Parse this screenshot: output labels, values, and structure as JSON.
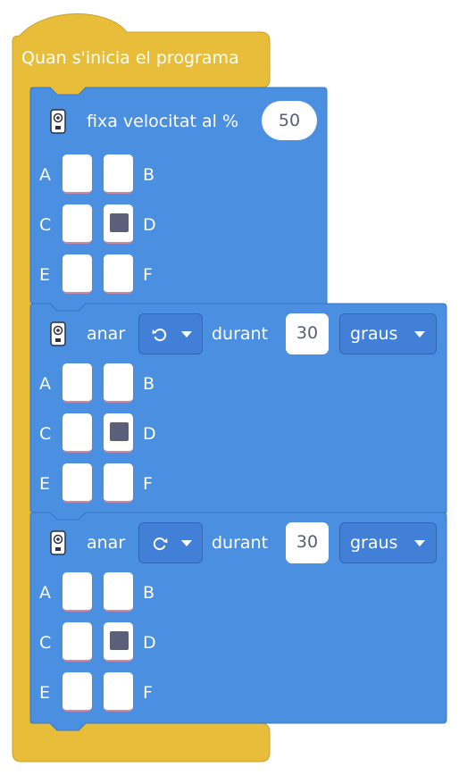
{
  "colors": {
    "event_yellow": "#e8bd3a",
    "motor_blue": "#4a8fe0",
    "port_filled": "#5b5f79",
    "value_text": "#575e75"
  },
  "hat": {
    "label": "Quan s'inicia el programa"
  },
  "blocks": [
    {
      "icon": "hub-icon",
      "label": "fixa velocitat al %",
      "value": "50",
      "ports": {
        "a": "A",
        "b": "B",
        "c": "C",
        "d": "D",
        "e": "E",
        "f": "F"
      },
      "selected_port": "D"
    },
    {
      "icon": "hub-icon",
      "label": "anar",
      "direction_icon": "counterclockwise-icon",
      "durant_label": "durant",
      "value": "30",
      "unit": "graus",
      "ports": {
        "a": "A",
        "b": "B",
        "c": "C",
        "d": "D",
        "e": "E",
        "f": "F"
      },
      "selected_port": "D"
    },
    {
      "icon": "hub-icon",
      "label": "anar",
      "direction_icon": "clockwise-icon",
      "durant_label": "durant",
      "value": "30",
      "unit": "graus",
      "ports": {
        "a": "A",
        "b": "B",
        "c": "C",
        "d": "D",
        "e": "E",
        "f": "F"
      },
      "selected_port": "D"
    }
  ]
}
